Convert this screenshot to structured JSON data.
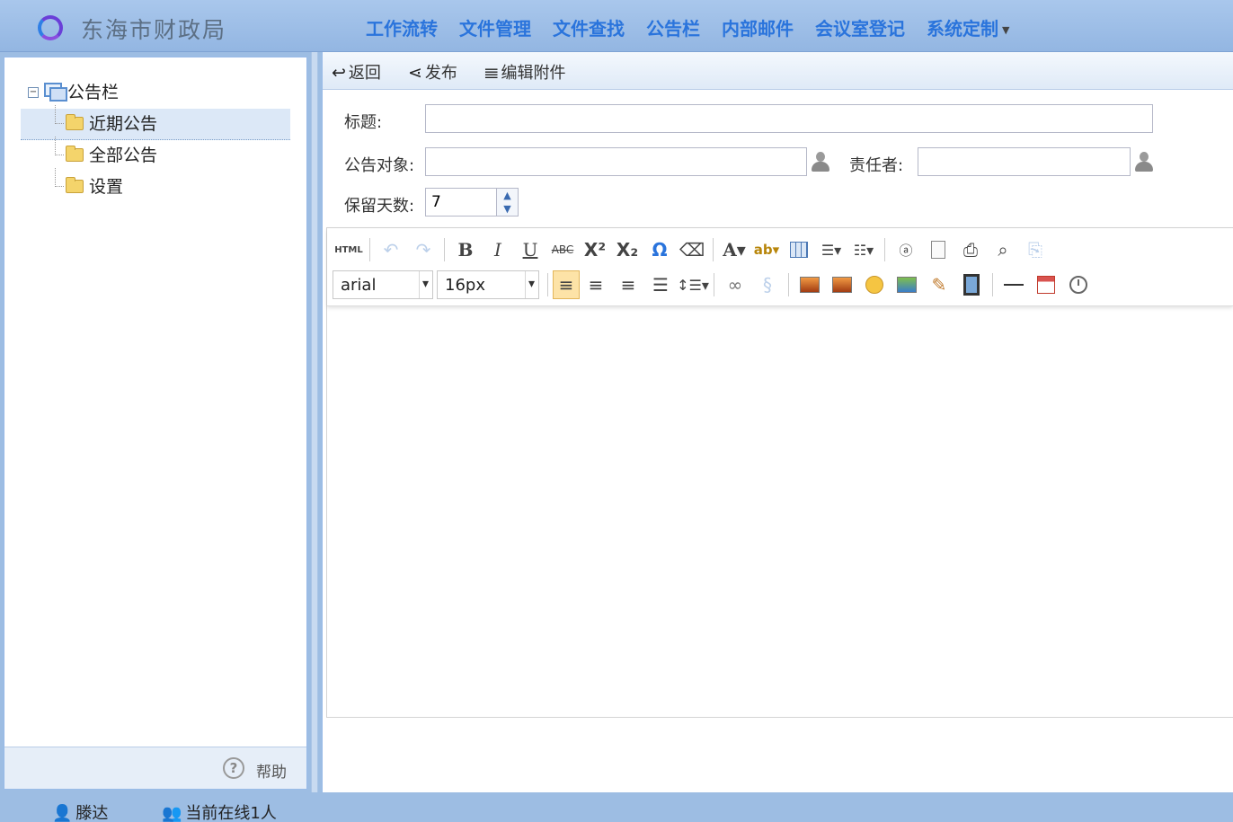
{
  "app": {
    "title": "东海市财政局"
  },
  "nav": {
    "items": [
      "工作流转",
      "文件管理",
      "文件查找",
      "公告栏",
      "内部邮件",
      "会议室登记",
      "系统定制"
    ]
  },
  "sidebar": {
    "root": "公告栏",
    "items": [
      "近期公告",
      "全部公告",
      "设置"
    ],
    "selected": "近期公告",
    "help_label": "帮助"
  },
  "toolbar": {
    "back_label": "返回",
    "publish_label": "发布",
    "attach_label": "编辑附件"
  },
  "form": {
    "title_label": "标题:",
    "title_value": "",
    "target_label": "公告对象:",
    "target_value": "",
    "owner_label": "责任者:",
    "owner_value": "",
    "days_label": "保留天数:",
    "days_value": "7"
  },
  "editor": {
    "html_label": "HTML",
    "font_family": "arial",
    "font_size": "16px",
    "content": ""
  },
  "status": {
    "user": "滕达",
    "online": "当前在线1人"
  },
  "colors": {
    "accent": "#2a74dc",
    "header_bg": "#9dbde3",
    "selected_bg": "#dce8f7"
  }
}
